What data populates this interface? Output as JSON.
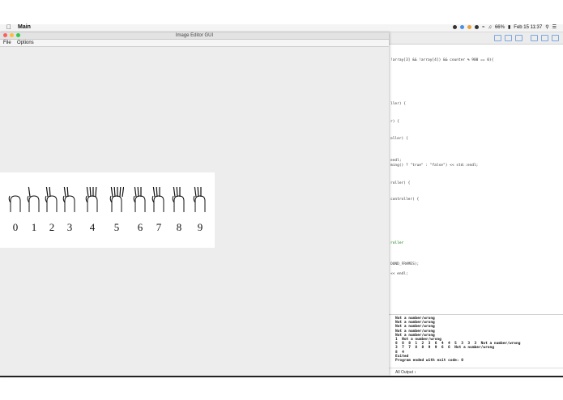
{
  "menubar": {
    "app_name": "Main",
    "battery": "66%",
    "datetime": "Feb 15  11:37"
  },
  "window": {
    "title": "Image Editor GUI",
    "menus": [
      "File",
      "Options"
    ]
  },
  "canvas": {
    "digits": [
      "0",
      "1",
      "2",
      "3",
      "4",
      "5",
      "6",
      "7",
      "8",
      "9"
    ]
  },
  "ide": {
    "code_lines": [
      "!array[3] && !array[4]) && counter % 900 == 0){",
      "ller) {",
      "r) {",
      "oller) {",
      "endl;",
      "ming() ? \"true\" : \"false\") << std::endl;",
      "roller) {",
      "controller) {",
      "roller",
      "OUND_FRAMES);",
      "<< endl;"
    ],
    "console_lines": [
      "Not a number/wrong",
      "Not a number/wrong",
      "Not a number/wrong",
      "Not a number/wrong",
      "Not a number/wrong",
      "1  Not a number/wrong",
      "8  8  8  1  2  3  6  4  4  5  3  3  3  Not a number/wrong",
      "3  7  7  8  8  9  9  6  6  Not a number/wrong",
      "8  4",
      "Exited",
      "Program ended with exit code: 0"
    ],
    "output_selector": "All Output ↕"
  },
  "colors": {
    "close": "#fc605b",
    "minimize": "#fdbc40",
    "zoom": "#34c84a",
    "accent": "#4a90e2"
  }
}
